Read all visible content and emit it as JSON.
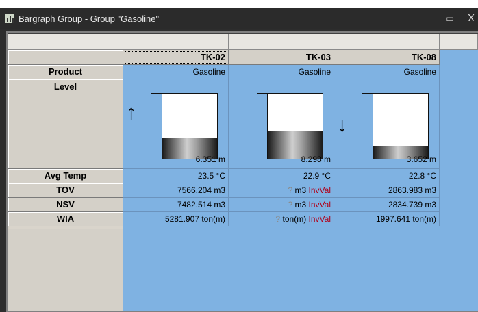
{
  "window": {
    "title": "Bargraph Group - Group \"Gasoline\"",
    "minimize": "_",
    "maximize": "▭",
    "close": "X"
  },
  "rows": {
    "product": "Product",
    "level": "Level",
    "avg_temp": "Avg Temp",
    "tov": "TOV",
    "nsv": "NSV",
    "wia": "WIA"
  },
  "tanks": [
    {
      "name": "TK-02",
      "product": "Gasoline",
      "level": "6.351 m",
      "level_fill_fraction": 0.33,
      "trend": "up",
      "trend_glyph": "↑",
      "avg_temp": "23.5 °C",
      "tov": {
        "value": "7566.204 m3"
      },
      "nsv": {
        "value": "7482.514 m3"
      },
      "wia": {
        "value": "5281.907 ton(m)"
      }
    },
    {
      "name": "TK-03",
      "product": "Gasoline",
      "level": "8.298 m",
      "level_fill_fraction": 0.43,
      "trend": "none",
      "trend_glyph": "",
      "avg_temp": "22.9 °C",
      "tov": {
        "q": "?",
        "unit": "m3",
        "invalid": "InvVal"
      },
      "nsv": {
        "q": "?",
        "unit": "m3",
        "invalid": "InvVal"
      },
      "wia": {
        "q": "?",
        "unit": "ton(m)",
        "invalid": "InvVal"
      }
    },
    {
      "name": "TK-08",
      "product": "Gasoline",
      "level": "3.652 m",
      "level_fill_fraction": 0.19,
      "trend": "down",
      "trend_glyph": "↓",
      "avg_temp": "22.8 °C",
      "tov": {
        "value": "2863.983 m3"
      },
      "nsv": {
        "value": "2834.739 m3"
      },
      "wia": {
        "value": "1997.641 ton(m)"
      }
    }
  ],
  "colors": {
    "grid_background": "#7fb2e2",
    "header_background": "#d4d0c8",
    "invalid_text": "#b0001a"
  }
}
